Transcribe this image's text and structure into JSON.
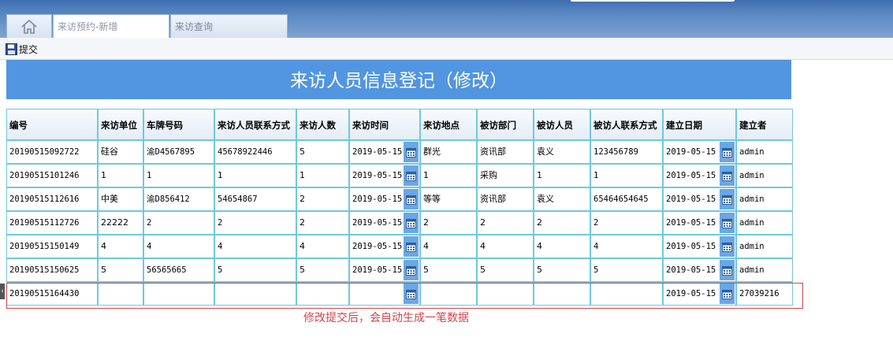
{
  "tabs": [
    {
      "label": ""
    },
    {
      "label": "来访预约-新增"
    },
    {
      "label": "来访查询"
    }
  ],
  "toolbar": {
    "submit_label": "提交"
  },
  "form": {
    "title": "来访人员信息登记（修改）"
  },
  "table": {
    "columns": [
      "编号",
      "来访单位",
      "车牌号码",
      "来访人员联系方式",
      "来访人数",
      "来访时间",
      "来访地点",
      "被访部门",
      "被访人员",
      "被访人联系方式",
      "建立日期",
      "建立者"
    ],
    "rows": [
      [
        "20190515092722",
        "硅谷",
        "渝D4567895",
        "45678922446",
        "5",
        "2019-05-15",
        "群光",
        "资讯部",
        "袁义",
        "123456789",
        "2019-05-15",
        "admin"
      ],
      [
        "20190515101246",
        "1",
        "1",
        "1",
        "1",
        "2019-05-15",
        "1",
        "采购",
        "1",
        "1",
        "2019-05-15",
        "admin"
      ],
      [
        "20190515112616",
        "中美",
        "渝D856412",
        "54654867",
        "2",
        "2019-05-15",
        "等等",
        "资讯部",
        "袁义",
        "65464654645",
        "2019-05-15",
        "admin"
      ],
      [
        "20190515112726",
        "22222",
        "2",
        "2",
        "2",
        "2019-05-15",
        "2",
        "2",
        "2",
        "2",
        "2019-05-15",
        "admin"
      ],
      [
        "20190515150149",
        "4",
        "4",
        "4",
        "4",
        "2019-05-15",
        "4",
        "4",
        "4",
        "4",
        "2019-05-15",
        "admin"
      ],
      [
        "20190515150625",
        "5",
        "56565665",
        "5",
        "5",
        "2019-05-15",
        "5",
        "5",
        "5",
        "5",
        "2019-05-15",
        "admin"
      ],
      [
        "20190515164430",
        "",
        "",
        "",
        "",
        "",
        "",
        "",
        "",
        "",
        "2019-05-15",
        "27039216"
      ]
    ]
  },
  "note": "修改提交后，会自动生成一笔数据",
  "colors": {
    "title_bg": "#5295e0",
    "cell_border": "#6ec8e2",
    "note": "#d6424a"
  }
}
